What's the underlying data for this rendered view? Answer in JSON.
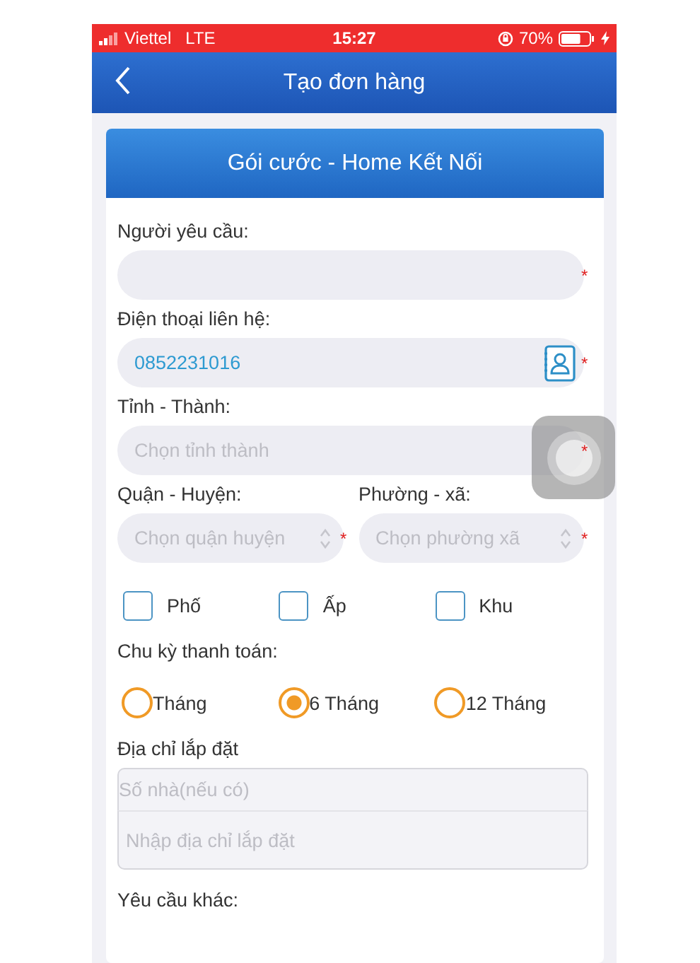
{
  "status_bar": {
    "carrier": "Viettel",
    "network": "LTE",
    "time": "15:27",
    "battery": "70%"
  },
  "header": {
    "title": "Tạo đơn hàng"
  },
  "card": {
    "title": "Gói cước - Home Kết Nối"
  },
  "requester": {
    "label": "Người yêu cầu:",
    "required_mark": "*"
  },
  "phone": {
    "label": "Điện thoại liên hệ:",
    "value": "0852231016",
    "required_mark": "*"
  },
  "province": {
    "label": "Tỉnh - Thành:",
    "placeholder": "Chọn tỉnh thành",
    "required_mark": "*"
  },
  "district": {
    "label": "Quận - Huyện:",
    "placeholder": "Chọn quận huyện",
    "required_mark": "*"
  },
  "ward": {
    "label": "Phường - xã:",
    "placeholder": "Chọn phường xã",
    "required_mark": "*"
  },
  "area_types": [
    {
      "label": "Phố",
      "checked": false
    },
    {
      "label": "Ấp",
      "checked": false
    },
    {
      "label": "Khu",
      "checked": false
    }
  ],
  "billing": {
    "label": "Chu kỳ thanh toán:",
    "options": [
      {
        "label": "Tháng",
        "selected": false
      },
      {
        "label": "6 Tháng",
        "selected": true
      },
      {
        "label": "12 Tháng",
        "selected": false
      }
    ]
  },
  "address": {
    "label": "Địa chỉ lắp đặt",
    "house_placeholder": "Số nhà(nếu có)",
    "street_placeholder": "Nhập địa chỉ lắp đặt"
  },
  "other": {
    "label": "Yêu cầu khác:"
  }
}
